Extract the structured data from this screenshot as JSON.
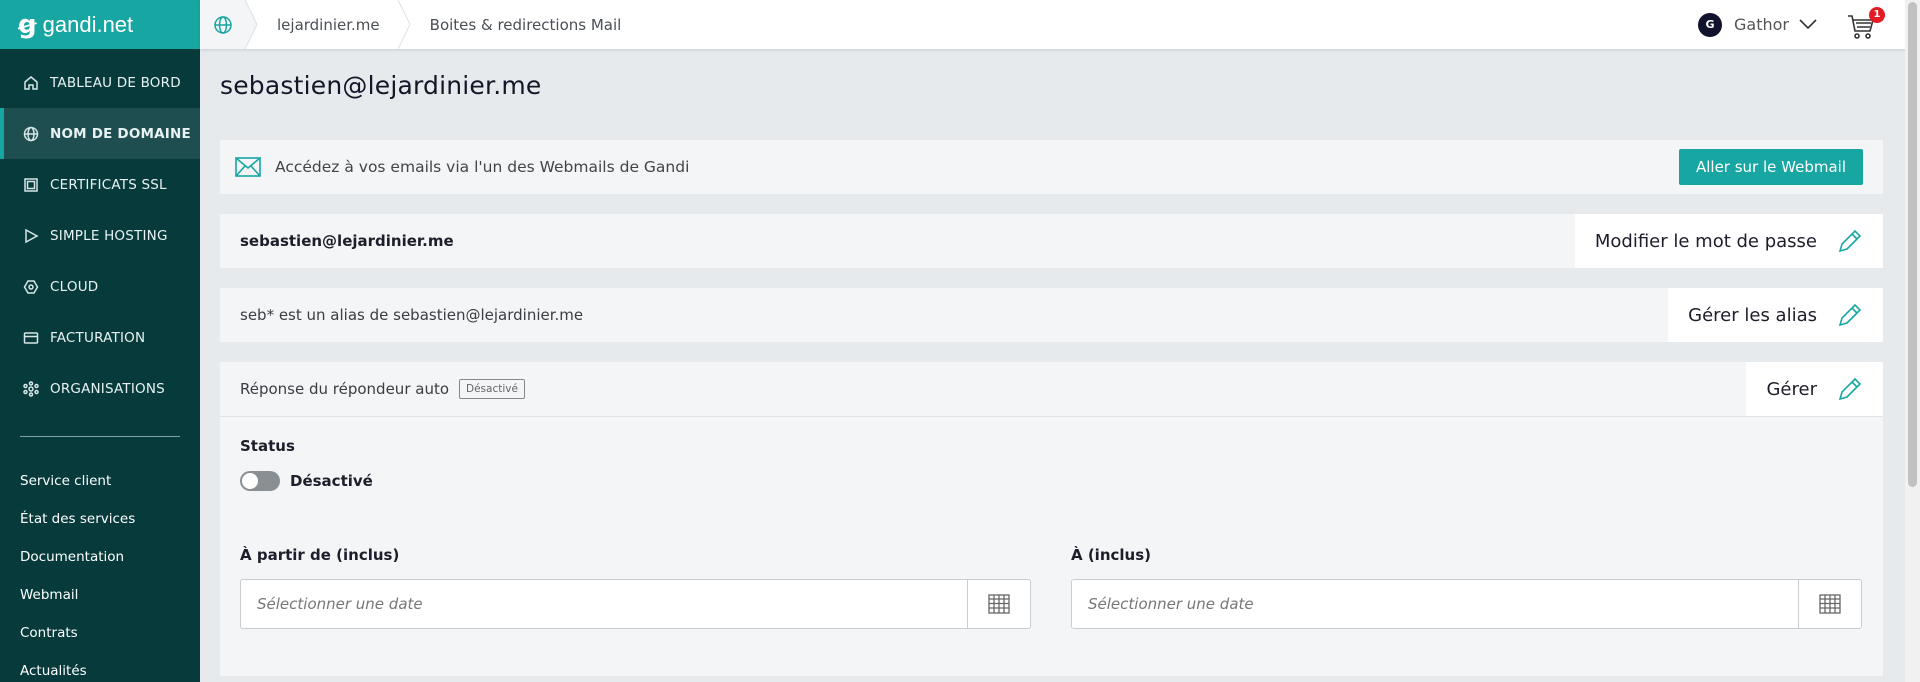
{
  "brand": {
    "name": "gandi.net",
    "accent": "#17a6a2",
    "sidebar_bg": "#073b3b"
  },
  "sidebar": {
    "nav": [
      {
        "label": "TABLEAU DE BORD",
        "icon": "home-icon"
      },
      {
        "label": "NOM DE DOMAINE",
        "icon": "globe-icon",
        "active": true
      },
      {
        "label": "CERTIFICATS SSL",
        "icon": "certificate-icon"
      },
      {
        "label": "SIMPLE HOSTING",
        "icon": "play-icon"
      },
      {
        "label": "CLOUD",
        "icon": "cloud-icon"
      },
      {
        "label": "FACTURATION",
        "icon": "credit-card-icon"
      },
      {
        "label": "ORGANISATIONS",
        "icon": "organization-icon"
      }
    ],
    "links": [
      "Service client",
      "État des services",
      "Documentation",
      "Webmail",
      "Contrats",
      "Actualités"
    ]
  },
  "topbar": {
    "breadcrumb": [
      "lejardinier.me",
      "Boites & redirections Mail"
    ],
    "user": {
      "initial": "G",
      "name": "Gathor"
    },
    "cart_count": "1"
  },
  "main": {
    "title": "sebastien@lejardinier.me",
    "webmail": {
      "text": "Accédez à vos emails via l'un des Webmails de Gandi",
      "button": "Aller sur le Webmail"
    },
    "password_row": {
      "label": "sebastien@lejardinier.me",
      "action": "Modifier le mot de passe"
    },
    "alias_row": {
      "label": "seb* est un alias de sebastien@lejardinier.me",
      "action": "Gérer les alias"
    },
    "autoresponder_row": {
      "label": "Réponse du répondeur auto",
      "badge": "Désactivé",
      "action": "Gérer"
    },
    "autoresponder": {
      "status_title": "Status",
      "toggle_label": "Désactivé",
      "toggle_on": false,
      "from_label": "À partir de (inclus)",
      "to_label": "À (inclus)",
      "date_placeholder": "Sélectionner une date"
    }
  }
}
